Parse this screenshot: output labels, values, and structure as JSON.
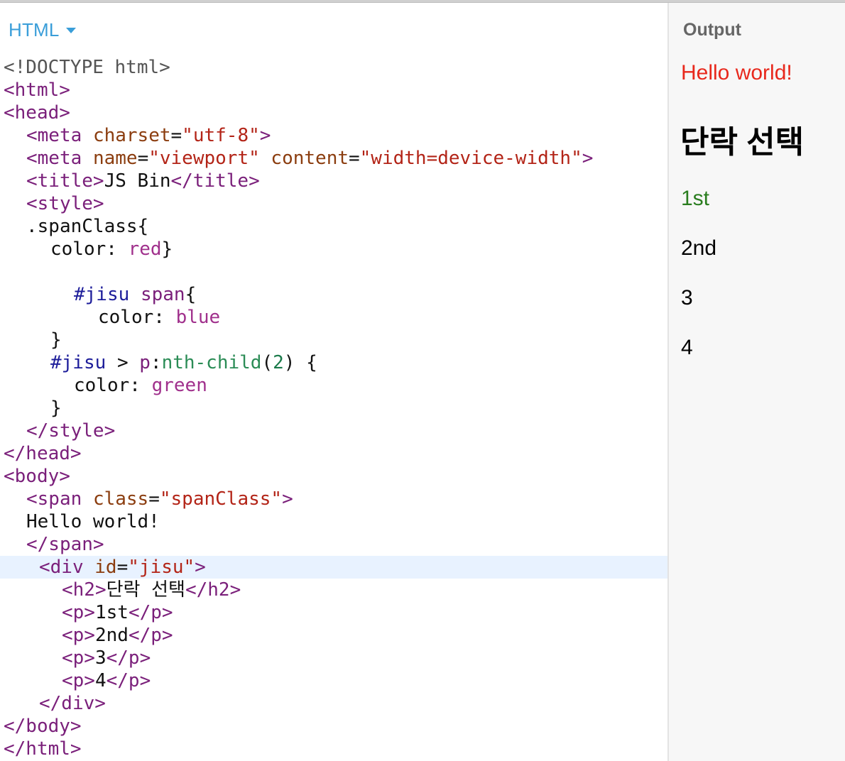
{
  "editor": {
    "panel_label": "HTML",
    "code": {
      "doctype": "<!DOCTYPE html>",
      "html_open": "<html>",
      "head_open": "<head>",
      "meta_open": "<meta",
      "charset_attr": "charset",
      "charset_val": "\"utf-8\"",
      "name_attr": "name",
      "name_val": "\"viewport\"",
      "content_attr": "content",
      "content_val": "\"width=device-width\"",
      "title_open": "<title>",
      "title_text": "JS Bin",
      "title_close": "</title>",
      "style_open": "<style>",
      "span_class_sel": ".spanClass{",
      "color_prop": "color:",
      "red_val": "red",
      "close_brace": "}",
      "jisu_sel": "#jisu",
      "span_sel": "span",
      "open_brace": "{",
      "blue_val": "blue",
      "gt": ">",
      "p_sel": "p",
      "colon": ":",
      "nth_child": "nth-child",
      "paren_open": "(",
      "two": "2",
      "paren_close": ")",
      "green_val": "green",
      "style_close": "</style>",
      "head_close": "</head>",
      "body_open": "<body>",
      "span_open": "<span",
      "class_attr": "class",
      "class_val": "\"spanClass\"",
      "tag_end": ">",
      "hello_text": "Hello world!",
      "span_close": "</span>",
      "div_open": "<div",
      "id_attr": "id",
      "id_val": "\"jisu\"",
      "equals": "=",
      "h2_open": "<h2>",
      "h2_text": "단락 선택",
      "h2_close": "</h2>",
      "p_open": "<p>",
      "p_close": "</p>",
      "p1_text": "1st",
      "p2_text": "2nd",
      "p3_text": "3",
      "p4_text": "4",
      "div_close": "</div>",
      "body_close": "</body>",
      "html_close": "</html>"
    }
  },
  "output": {
    "title": "Output",
    "hello": "Hello world!",
    "heading": "단락 선택",
    "paragraphs": [
      "1st",
      "2nd",
      "3",
      "4"
    ]
  },
  "colors": {
    "accent": "#3a9ed9",
    "tag": "#7a1f7a",
    "attribute": "#8b3d0f",
    "string": "#b32417",
    "keyword_value": "#a0308c",
    "output_red": "#e8281c",
    "output_green": "#2a7d1f",
    "active_line": "#e8f2ff"
  }
}
